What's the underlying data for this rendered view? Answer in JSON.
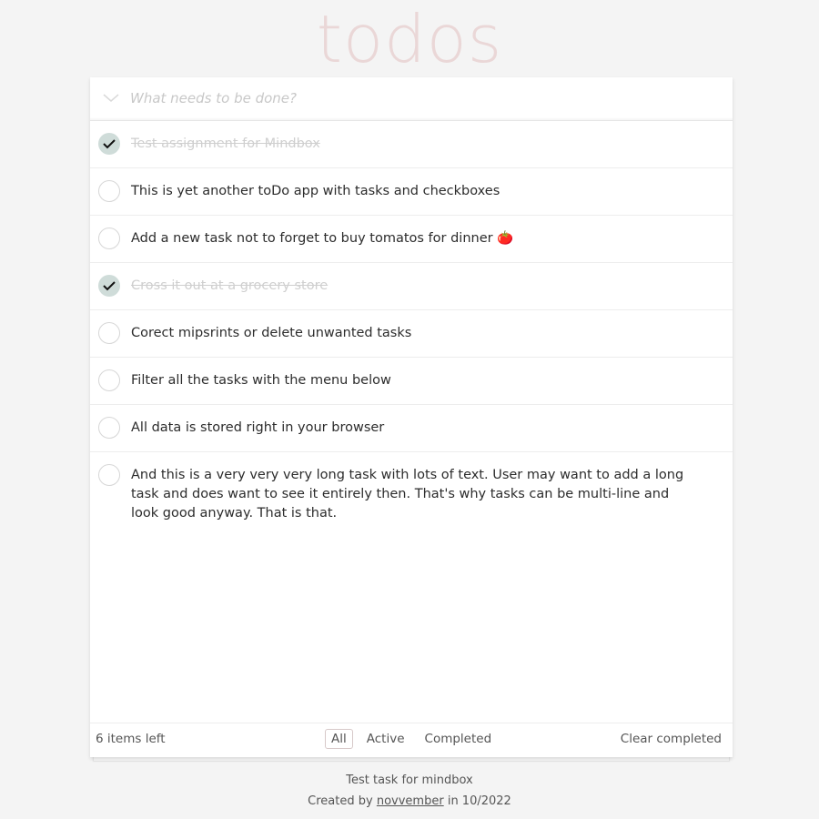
{
  "app": {
    "title": "todos"
  },
  "new_todo": {
    "placeholder": "What needs to be done?",
    "value": ""
  },
  "todos": [
    {
      "text": "Test assignment for Mindbox",
      "completed": true
    },
    {
      "text": "This is yet another toDo app with tasks and checkboxes",
      "completed": false
    },
    {
      "text": "Add a new task not to forget to buy tomatos for dinner 🍅",
      "completed": false
    },
    {
      "text": "Cross it out at a grocery store",
      "completed": true
    },
    {
      "text": "Corect mipsrints or delete unwanted tasks",
      "completed": false
    },
    {
      "text": "Filter all the tasks with the menu below",
      "completed": false
    },
    {
      "text": "All data is stored right in your browser",
      "completed": false
    },
    {
      "text": "And this is a very very very long task with lots of text. User may want to add a long task and does want to see it entirely then. That's why tasks can be multi-line and look good anyway. That is that.",
      "completed": false
    }
  ],
  "footer": {
    "items_left": "6 items left",
    "filters": [
      "All",
      "Active",
      "Completed"
    ],
    "selected_filter": "All",
    "clear_completed": "Clear completed"
  },
  "info": {
    "line1": "Test task for mindbox",
    "created_prefix": "Created by",
    "author": "novvember",
    "created_suffix": "in 10/2022"
  },
  "colors": {
    "title": "#ead7d7",
    "check_done_bg": "#cfdcd9",
    "background": "#f4f4f4"
  }
}
